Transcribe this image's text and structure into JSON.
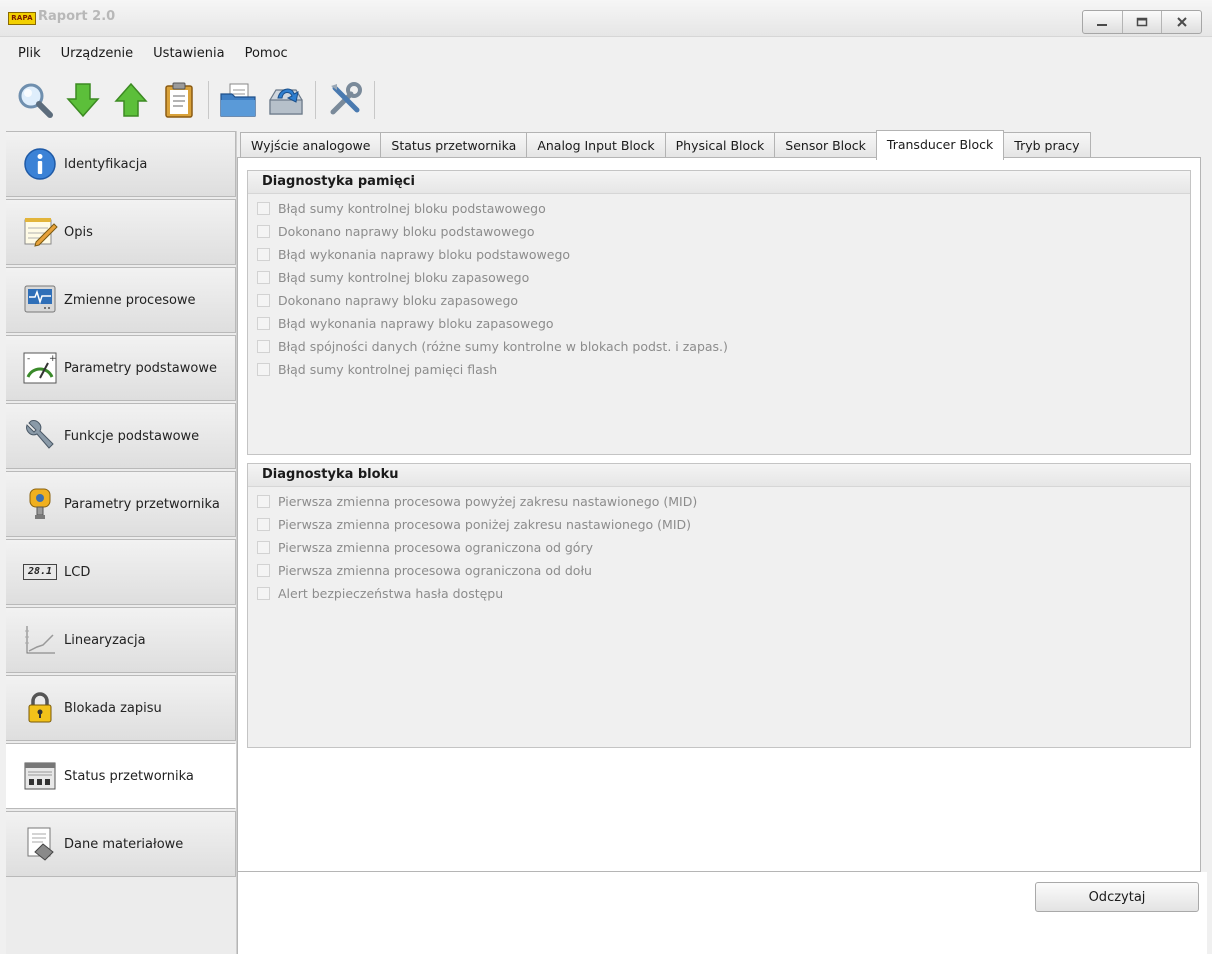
{
  "window": {
    "logo_text": "RAPA",
    "title": "Raport 2.0"
  },
  "menu": [
    "Plik",
    "Urządzenie",
    "Ustawienia",
    "Pomoc"
  ],
  "sidebar": {
    "items": [
      {
        "label": "Identyfikacja",
        "icon": "info-icon"
      },
      {
        "label": "Opis",
        "icon": "notepad-pencil-icon"
      },
      {
        "label": "Zmienne procesowe",
        "icon": "monitor-pulse-icon"
      },
      {
        "label": "Parametry podstawowe",
        "icon": "gauge-icon"
      },
      {
        "label": "Funkcje podstawowe",
        "icon": "wrench-icon"
      },
      {
        "label": "Parametry przetwornika",
        "icon": "transmitter-icon"
      },
      {
        "label": "LCD",
        "icon": "lcd-icon",
        "lcd_text": "28.1"
      },
      {
        "label": "Linearyzacja",
        "icon": "line-chart-icon"
      },
      {
        "label": "Blokada zapisu",
        "icon": "padlock-icon"
      },
      {
        "label": "Status przetwornika",
        "icon": "status-panel-icon",
        "active": true
      },
      {
        "label": "Dane materiałowe",
        "icon": "document-diamond-icon"
      }
    ]
  },
  "tabs": [
    {
      "label": "Wyjście analogowe"
    },
    {
      "label": "Status przetwornika"
    },
    {
      "label": "Analog Input Block"
    },
    {
      "label": "Physical Block"
    },
    {
      "label": "Sensor Block"
    },
    {
      "label": "Transducer Block",
      "active": true
    },
    {
      "label": "Tryb pracy"
    }
  ],
  "groups": {
    "memory": {
      "title": "Diagnostyka pamięci",
      "items": [
        "Błąd sumy kontrolnej bloku podstawowego",
        "Dokonano naprawy bloku podstawowego",
        "Błąd wykonania naprawy bloku podstawowego",
        "Błąd sumy kontrolnej bloku zapasowego",
        "Dokonano naprawy bloku zapasowego",
        "Błąd wykonania naprawy bloku zapasowego",
        "Błąd spójności danych (różne sumy kontrolne w blokach podst. i zapas.)",
        "Błąd sumy kontrolnej pamięci flash"
      ]
    },
    "block": {
      "title": "Diagnostyka bloku",
      "items": [
        "Pierwsza zmienna procesowa powyżej zakresu nastawionego (MID)",
        "Pierwsza zmienna procesowa poniżej zakresu nastawionego (MID)",
        "Pierwsza zmienna procesowa ograniczona od góry",
        "Pierwsza zmienna procesowa ograniczona od dołu",
        "Alert bezpieczeństwa hasła dostępu"
      ]
    }
  },
  "buttons": {
    "read": "Odczytaj"
  }
}
